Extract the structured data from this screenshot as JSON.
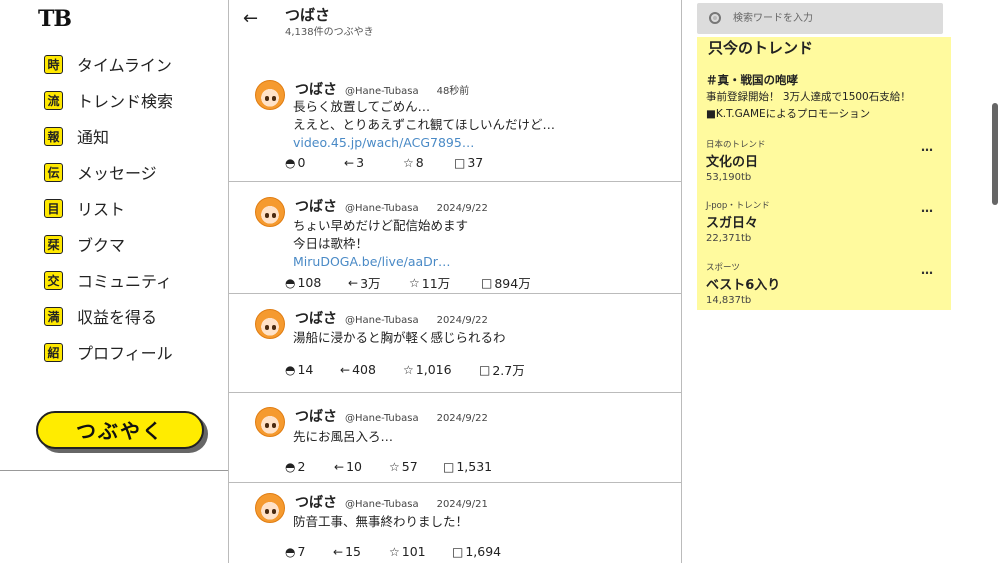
{
  "logo": "TB",
  "nav": [
    {
      "icon": "時",
      "icon_name": "timeline-icon",
      "label": "タイムライン"
    },
    {
      "icon": "流",
      "icon_name": "trend-search-icon",
      "label": "トレンド検索"
    },
    {
      "icon": "報",
      "icon_name": "notification-icon",
      "label": "通知"
    },
    {
      "icon": "伝",
      "icon_name": "message-icon",
      "label": "メッセージ"
    },
    {
      "icon": "目",
      "icon_name": "list-icon",
      "label": "リスト"
    },
    {
      "icon": "栞",
      "icon_name": "bookmark-icon",
      "label": "ブクマ"
    },
    {
      "icon": "交",
      "icon_name": "community-icon",
      "label": "コミュニティ"
    },
    {
      "icon": "満",
      "icon_name": "monetize-icon",
      "label": "収益を得る"
    },
    {
      "icon": "紹",
      "icon_name": "profile-icon",
      "label": "プロフィール"
    }
  ],
  "post_button": "つぶやく",
  "header": {
    "back": "←",
    "name": "つばさ",
    "count": "4,138件のつぶやき"
  },
  "posts": [
    {
      "author": "つばさ",
      "handle": "@Hane-Tubasa",
      "time": "48秒前",
      "lines": [
        "長らく放置してごめん…",
        "ええと、とりあえずこれ観てほしいんだけど…"
      ],
      "link": "video.45.jp/wach/ACG7895…",
      "replies": "0",
      "reposts": "3",
      "likes": "8",
      "views": "37"
    },
    {
      "author": "つばさ",
      "handle": "@Hane-Tubasa",
      "time": "2024/9/22",
      "lines": [
        "ちょい早めだけど配信始めます",
        "今日は歌枠！"
      ],
      "link": "MiruDOGA.be/live/aaDr…",
      "replies": "108",
      "reposts": "3万",
      "likes": "11万",
      "views": "894万"
    },
    {
      "author": "つばさ",
      "handle": "@Hane-Tubasa",
      "time": "2024/9/22",
      "lines": [
        "湯船に浸かると胸が軽く感じられるわ"
      ],
      "link": "",
      "replies": "14",
      "reposts": "408",
      "likes": "1,016",
      "views": "2.7万"
    },
    {
      "author": "つばさ",
      "handle": "@Hane-Tubasa",
      "time": "2024/9/22",
      "lines": [
        "先にお風呂入ろ…"
      ],
      "link": "",
      "replies": "2",
      "reposts": "10",
      "likes": "57",
      "views": "1,531"
    },
    {
      "author": "つばさ",
      "handle": "@Hane-Tubasa",
      "time": "2024/9/21",
      "lines": [
        "防音工事、無事終わりました！"
      ],
      "link": "",
      "replies": "7",
      "reposts": "15",
      "likes": "101",
      "views": "1,694"
    }
  ],
  "action_icons": {
    "reply": "◓",
    "repost": "←",
    "like": "☆",
    "view": "□"
  },
  "search": {
    "placeholder": "検索ワードを入力"
  },
  "trends": {
    "title": "只今のトレンド",
    "featured": {
      "title": "＃真・戦国の咆哮",
      "desc": "事前登録開始！ 3万人達成で1500石支給！",
      "promo": "■K.T.GAMEによるプロモーション"
    },
    "items": [
      {
        "category": "日本のトレンド",
        "name": "文化の日",
        "count": "53,190tb",
        "more": "…"
      },
      {
        "category": "J-pop・トレンド",
        "name": "スガ日々",
        "count": "22,371tb",
        "more": "…"
      },
      {
        "category": "スポーツ",
        "name": "ベスト6入り",
        "count": "14,837tb",
        "more": "…"
      }
    ]
  },
  "colors": {
    "accent_yellow": "#ffec00",
    "trend_bg": "#fffa9e",
    "link": "#4a8ac6"
  }
}
